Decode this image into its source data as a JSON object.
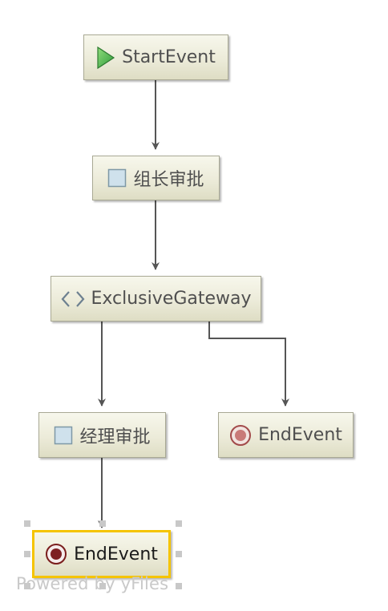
{
  "diagram": {
    "nodes": [
      {
        "id": "start",
        "label": "StartEvent",
        "icon": "start-triangle-icon"
      },
      {
        "id": "task1",
        "label": "组长审批",
        "icon": "task-square-icon"
      },
      {
        "id": "gateway",
        "label": "ExclusiveGateway",
        "icon": "gateway-diamond-icon"
      },
      {
        "id": "task2",
        "label": "经理审批",
        "icon": "task-square-icon"
      },
      {
        "id": "end1",
        "label": "EndEvent",
        "icon": "end-circle-icon"
      },
      {
        "id": "end2",
        "label": "EndEvent",
        "icon": "end-circle-icon",
        "selected": true
      }
    ],
    "edges": [
      {
        "from": "start",
        "to": "task1"
      },
      {
        "from": "task1",
        "to": "gateway"
      },
      {
        "from": "gateway",
        "to": "task2"
      },
      {
        "from": "gateway",
        "to": "end1"
      },
      {
        "from": "task2",
        "to": "end2"
      }
    ]
  },
  "colors": {
    "selection_border": "#f5c400",
    "edge": "#555555",
    "node_border": "#a9a994"
  },
  "watermark": "Powered by yFiles"
}
